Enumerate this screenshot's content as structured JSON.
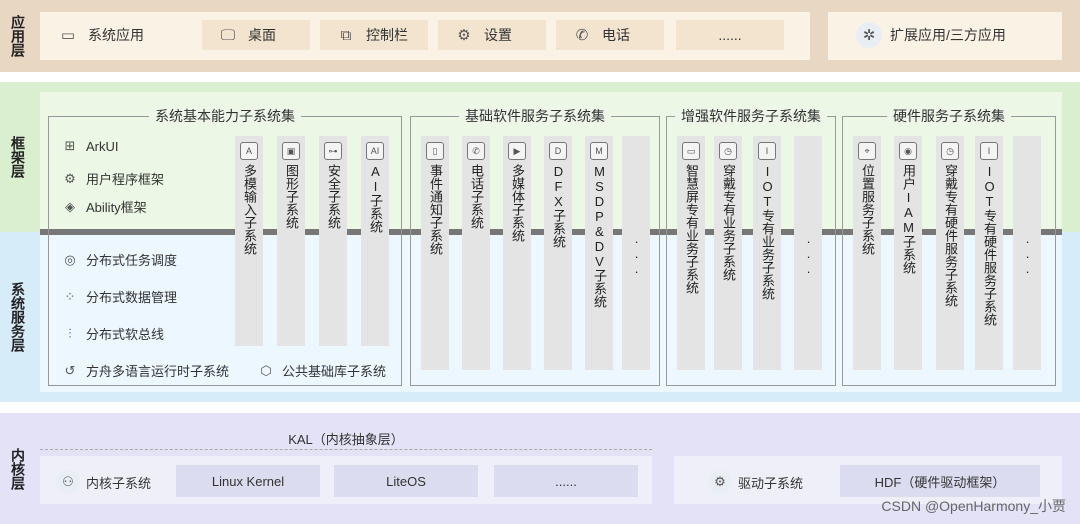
{
  "layers": {
    "app": "应用层",
    "framework": "框架层",
    "system": "系统服务层",
    "kernel": "内核层"
  },
  "app_layer": {
    "items": [
      {
        "label": "系统应用",
        "icon": "system-app-icon"
      },
      {
        "label": "桌面",
        "icon": "monitor-icon"
      },
      {
        "label": "控制栏",
        "icon": "control-bar-icon"
      },
      {
        "label": "设置",
        "icon": "gear-icon"
      },
      {
        "label": "电话",
        "icon": "phone-icon"
      },
      {
        "label": "......",
        "icon": ""
      }
    ],
    "ext": {
      "label": "扩展应用/三方应用",
      "icon": "puzzle-icon"
    }
  },
  "basic_capability": {
    "title": "系统基本能力子系统集",
    "features": [
      {
        "label": "ArkUI",
        "icon": "arkui-icon"
      },
      {
        "label": "用户程序框架",
        "icon": "app-framework-icon"
      },
      {
        "label": "Ability框架",
        "icon": "layers-icon"
      },
      {
        "label": "分布式任务调度",
        "icon": "task-schedule-icon"
      },
      {
        "label": "分布式数据管理",
        "icon": "data-manage-icon"
      },
      {
        "label": "分布式软总线",
        "icon": "softbus-icon"
      },
      {
        "label": "方舟多语言运行时子系统",
        "icon": "runtime-icon"
      },
      {
        "label": "公共基础库子系统",
        "icon": "cube-icon"
      }
    ],
    "columns": [
      "多模输入子系统",
      "图形子系统",
      "安全子系统",
      "AI子系统"
    ]
  },
  "basic_software": {
    "title": "基础软件服务子系统集",
    "columns": [
      "事件通知子系统",
      "电话子系统",
      "多媒体子系统",
      "DFX子系统",
      "MSDP&DV子系统",
      "..."
    ]
  },
  "enhanced_software": {
    "title": "增强软件服务子系统集",
    "columns": [
      "智慧屏专有业务子系统",
      "穿戴专有业务子系统",
      "IOT专有业务子系统",
      "..."
    ]
  },
  "hardware_service": {
    "title": "硬件服务子系统集",
    "columns": [
      "位置服务子系统",
      "用户IAM子系统",
      "穿戴专有硬件服务子系统",
      "IOT专有硬件服务子系统",
      "..."
    ]
  },
  "kernel_layer": {
    "kal": "KAL（内核抽象层）",
    "kernel_subsystem": "内核子系统",
    "kernels": [
      "Linux Kernel",
      "LiteOS",
      "......"
    ],
    "driver_subsystem": "驱动子系统",
    "hdf": "HDF（硬件驱动框架）"
  },
  "watermark": "CSDN @OpenHarmony_小贾"
}
